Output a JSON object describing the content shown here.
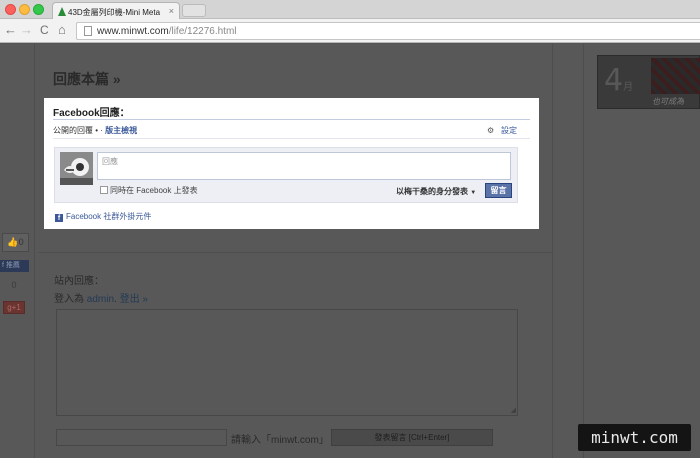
{
  "browser": {
    "tab_title": "43D金屬列印機-Mini Meta",
    "tab_close": "×",
    "url_host": "www.minwt.com",
    "url_path": "/life/12276.html",
    "back": "←",
    "forward": "→",
    "reload": "C",
    "home": "⌂"
  },
  "page": {
    "section_title": "回應本篇 »",
    "share": {
      "like_count": "0",
      "fb_share_label": "推薦",
      "count": "0",
      "gplus_label": "g+1"
    },
    "comments": {
      "title": "站內回應：",
      "logged_in_prefix": "登入為",
      "user": "admin",
      "logout": "登出 »",
      "captcha_label": "請輸入「minwt.com」",
      "submit_label": "發表留言 [Ctrl+Enter]"
    },
    "promo": {
      "month_number": "4",
      "month_suffix": "月",
      "tagline": "也可成為"
    },
    "watermark": "minwt.com"
  },
  "facebook": {
    "title": "Facebook回應：",
    "public_comments": "公開的回覆",
    "moderator_view": "版主檢視",
    "settings": "設定",
    "comment_placeholder": "回應",
    "crosspost_label": "同時在 Facebook 上發表",
    "post_as": "以梅干桑的身分發表",
    "post_button": "留言",
    "footer_label": "Facebook 社群外掛元件"
  },
  "colors": {
    "fb_blue": "#3b5998",
    "fb_button": "#5b74a8",
    "overlay": "#585858"
  }
}
